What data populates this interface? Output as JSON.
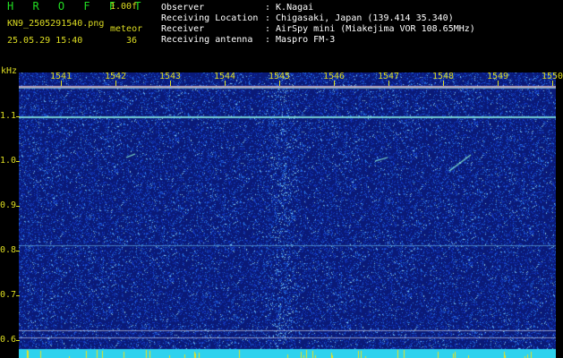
{
  "header": {
    "title": "H R O F F T",
    "version": "1.00f",
    "filename": "KN9_2505291540.png",
    "meteor_label": "meteor",
    "datetime": "25.05.29 15:40",
    "meteor_count": "36"
  },
  "info": [
    {
      "label": "Observer",
      "value": ": K.Nagai"
    },
    {
      "label": "Receiving Location",
      "value": ": Chigasaki, Japan (139.414 35.340)"
    },
    {
      "label": "Receiver",
      "value": ": AirSpy mini (Miakejima VOR 108.65MHz)"
    },
    {
      "label": "Receiving antenna",
      "value": ": Maspro FM-3"
    }
  ],
  "axis": {
    "unit": "kHz",
    "x_ticks": [
      "1541",
      "1542",
      "1543",
      "1544",
      "1545",
      "1546",
      "1547",
      "1548",
      "1549",
      "1550"
    ],
    "y_ticks": [
      "1.1",
      "1.0",
      "0.9",
      "0.8",
      "0.7",
      "0.6"
    ]
  },
  "colors": {
    "background": "#0a1a7a",
    "label": "#dddd22",
    "title": "#22dd22",
    "carrier": "#7ad7d7"
  }
}
